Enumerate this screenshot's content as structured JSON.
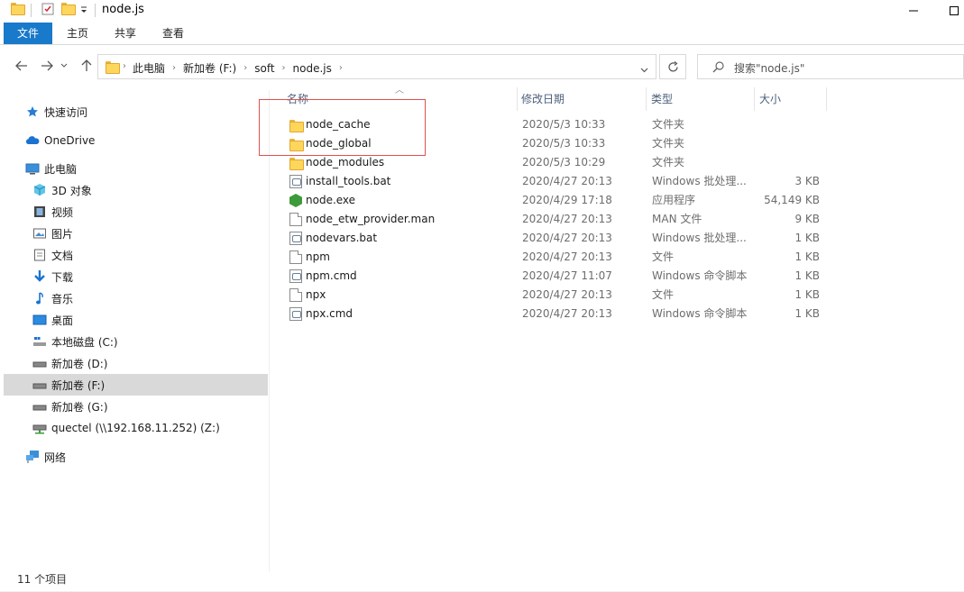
{
  "window": {
    "title": "node.js"
  },
  "ribbon": {
    "tabs": [
      "文件",
      "主页",
      "共享",
      "查看"
    ]
  },
  "address": {
    "crumbs": [
      "此电脑",
      "新加卷 (F:)",
      "soft",
      "node.js"
    ]
  },
  "search": {
    "placeholder": "搜索\"node.js\""
  },
  "nav": {
    "items": [
      {
        "label": "快速访问",
        "icon": "star-icon"
      },
      {
        "label": "OneDrive",
        "icon": "cloud-icon"
      },
      {
        "label": "此电脑",
        "icon": "computer-icon"
      },
      {
        "label": "3D 对象",
        "icon": "cube-icon"
      },
      {
        "label": "视频",
        "icon": "video-icon"
      },
      {
        "label": "图片",
        "icon": "picture-icon"
      },
      {
        "label": "文档",
        "icon": "document-icon"
      },
      {
        "label": "下载",
        "icon": "download-icon"
      },
      {
        "label": "音乐",
        "icon": "music-icon"
      },
      {
        "label": "桌面",
        "icon": "desktop-icon"
      },
      {
        "label": "本地磁盘 (C:)",
        "icon": "system-drive-icon"
      },
      {
        "label": "新加卷 (D:)",
        "icon": "drive-icon"
      },
      {
        "label": "新加卷 (F:)",
        "icon": "drive-icon",
        "selected": true
      },
      {
        "label": "新加卷 (G:)",
        "icon": "drive-icon"
      },
      {
        "label": "quectel (\\\\192.168.11.252) (Z:)",
        "icon": "network-drive-icon"
      },
      {
        "label": "网络",
        "icon": "network-icon"
      }
    ]
  },
  "columns": {
    "name": "名称",
    "date": "修改日期",
    "type": "类型",
    "size": "大小"
  },
  "files": [
    {
      "name": "node_cache",
      "date": "2020/5/3 10:33",
      "type": "文件夹",
      "size": "",
      "icon": "folder-icon"
    },
    {
      "name": "node_global",
      "date": "2020/5/3 10:33",
      "type": "文件夹",
      "size": "",
      "icon": "folder-icon"
    },
    {
      "name": "node_modules",
      "date": "2020/5/3 10:29",
      "type": "文件夹",
      "size": "",
      "icon": "folder-icon"
    },
    {
      "name": "install_tools.bat",
      "date": "2020/4/27 20:13",
      "type": "Windows 批处理...",
      "size": "3 KB",
      "icon": "batch-file-icon"
    },
    {
      "name": "node.exe",
      "date": "2020/4/29 17:18",
      "type": "应用程序",
      "size": "54,149 KB",
      "icon": "nodejs-exe-icon"
    },
    {
      "name": "node_etw_provider.man",
      "date": "2020/4/27 20:13",
      "type": "MAN 文件",
      "size": "9 KB",
      "icon": "file-icon"
    },
    {
      "name": "nodevars.bat",
      "date": "2020/4/27 20:13",
      "type": "Windows 批处理...",
      "size": "1 KB",
      "icon": "batch-file-icon"
    },
    {
      "name": "npm",
      "date": "2020/4/27 20:13",
      "type": "文件",
      "size": "1 KB",
      "icon": "file-icon"
    },
    {
      "name": "npm.cmd",
      "date": "2020/4/27 11:07",
      "type": "Windows 命令脚本",
      "size": "1 KB",
      "icon": "batch-file-icon"
    },
    {
      "name": "npx",
      "date": "2020/4/27 20:13",
      "type": "文件",
      "size": "1 KB",
      "icon": "file-icon"
    },
    {
      "name": "npx.cmd",
      "date": "2020/4/27 20:13",
      "type": "Windows 命令脚本",
      "size": "1 KB",
      "icon": "batch-file-icon"
    }
  ],
  "status": {
    "text": "11 个项目"
  },
  "colors": {
    "accent": "#1979ca",
    "folder": "#ffd65c",
    "highlight": "#e05050",
    "selected": "#d9d9d9"
  }
}
